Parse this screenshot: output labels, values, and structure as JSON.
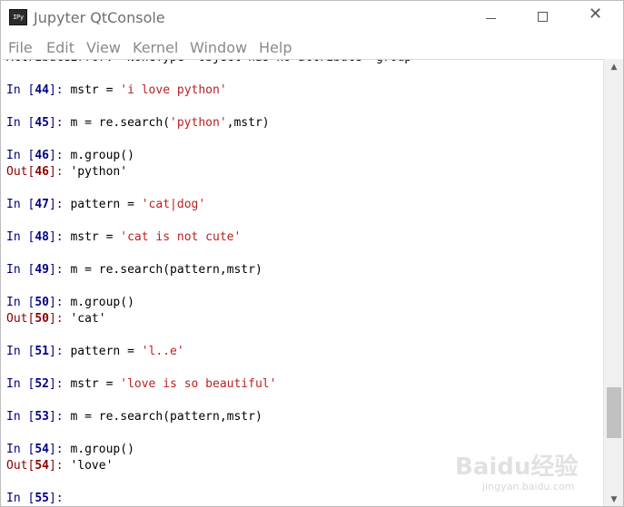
{
  "window": {
    "icon_label": "IPy",
    "title": "Jupyter QtConsole",
    "close_glyph": "✕"
  },
  "menu": {
    "items": [
      "File",
      "Edit",
      "View",
      "Kernel",
      "Window",
      "Help"
    ]
  },
  "console": {
    "error_line": "AttributeError: 'NoneType' object has no attribute 'group'",
    "cells": [
      {
        "n": "44",
        "code": "mstr = ",
        "str": "'i love python'",
        "tail": ""
      },
      {
        "n": "45",
        "code": "m = re.search(",
        "str": "'python'",
        "tail": ",mstr)"
      },
      {
        "n": "46",
        "code": "m.group()",
        "str": "",
        "tail": "",
        "out": "'python'"
      },
      {
        "n": "47",
        "code": "pattern = ",
        "str": "'cat|dog'",
        "tail": ""
      },
      {
        "n": "48",
        "code": "mstr = ",
        "str": "'cat is not cute'",
        "tail": ""
      },
      {
        "n": "49",
        "code": "m = re.search(pattern,mstr)",
        "str": "",
        "tail": ""
      },
      {
        "n": "50",
        "code": "m.group()",
        "str": "",
        "tail": "",
        "out": "'cat'"
      },
      {
        "n": "51",
        "code": "pattern = ",
        "str": "'l..e'",
        "tail": ""
      },
      {
        "n": "52",
        "code": "mstr = ",
        "str": "'love is so beautiful'",
        "tail": ""
      },
      {
        "n": "53",
        "code": "m = re.search(pattern,mstr)",
        "str": "",
        "tail": ""
      },
      {
        "n": "54",
        "code": "m.group()",
        "str": "",
        "tail": "",
        "out": "'love'"
      },
      {
        "n": "55",
        "code": "",
        "str": "",
        "tail": ""
      }
    ]
  },
  "scrollbar": {
    "up_glyph": "▲",
    "down_glyph": "▼",
    "position_fraction": 0.78
  },
  "watermark": {
    "text": "Baidu经验",
    "url": "jingyan.baidu.com"
  }
}
